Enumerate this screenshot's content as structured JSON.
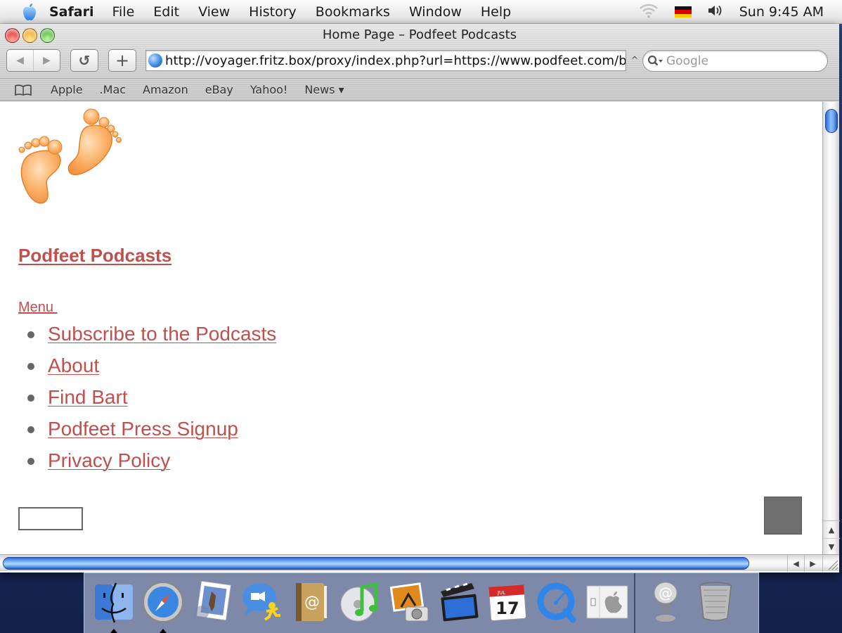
{
  "menubar": {
    "app_name": "Safari",
    "items": [
      "File",
      "Edit",
      "View",
      "History",
      "Bookmarks",
      "Window",
      "Help"
    ],
    "status": {
      "wifi": "wifi-icon",
      "input_flag": "german-flag-icon",
      "volume": "volume-icon",
      "clock": "Sun 9:45 AM"
    }
  },
  "window": {
    "title": "Home Page – Podfeet Podcasts",
    "toolbar": {
      "back_label": "◀",
      "forward_label": "▶",
      "reload_label": "↺",
      "add_bookmark_label": "+",
      "url": "http://voyager.fritz.box/proxy/index.php?url=https://www.podfeet.com/blog/",
      "snapback_label": "^",
      "search_placeholder": "Google"
    },
    "bookmarks_bar": {
      "items": [
        "Apple",
        ".Mac",
        "Amazon",
        "eBay",
        "Yahoo!",
        "News ▾"
      ]
    }
  },
  "page": {
    "site_title": "Podfeet Podcasts",
    "menu_label": "Menu ",
    "nav_items": [
      "Subscribe to the Podcasts",
      "About",
      "Find Bart",
      "Podfeet Press Signup",
      "Privacy Policy"
    ],
    "link_color": "#c0504d"
  },
  "scrollbars": {
    "up_arrow": "▲",
    "down_arrow": "▼",
    "left_arrow": "◀",
    "right_arrow": "▶"
  },
  "dock": {
    "apps": [
      {
        "name": "Finder",
        "running": true
      },
      {
        "name": "Safari",
        "running": true
      },
      {
        "name": "Mail",
        "running": false
      },
      {
        "name": "iChat",
        "running": false
      },
      {
        "name": "Address Book",
        "running": false
      },
      {
        "name": "iTunes",
        "running": false
      },
      {
        "name": "iPhoto",
        "running": false
      },
      {
        "name": "iMovie",
        "running": false
      },
      {
        "name": "iCal",
        "running": false
      },
      {
        "name": "QuickTime Player",
        "running": false
      },
      {
        "name": "System Preferences",
        "running": false
      }
    ],
    "others": [
      {
        "name": "Mail Downloads"
      },
      {
        "name": "Trash"
      }
    ],
    "ical_month": "JUL",
    "ical_day": "17"
  }
}
